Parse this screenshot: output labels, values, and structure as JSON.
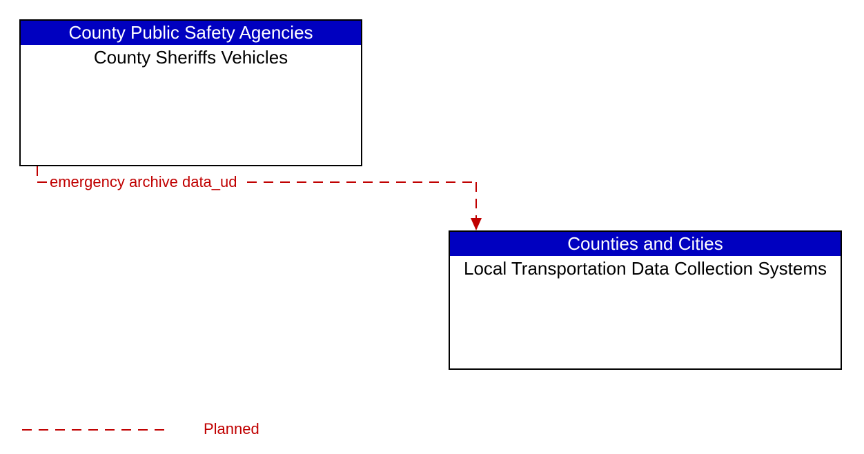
{
  "entities": {
    "source": {
      "header": "County Public Safety Agencies",
      "body": "County Sheriffs Vehicles"
    },
    "target": {
      "header": "Counties and Cities",
      "body": "Local Transportation Data Collection Systems"
    }
  },
  "flow": {
    "label": "emergency archive data_ud"
  },
  "legend": {
    "planned": "Planned"
  },
  "colors": {
    "header_bg": "#0000c0",
    "flow_color": "#c00000"
  }
}
